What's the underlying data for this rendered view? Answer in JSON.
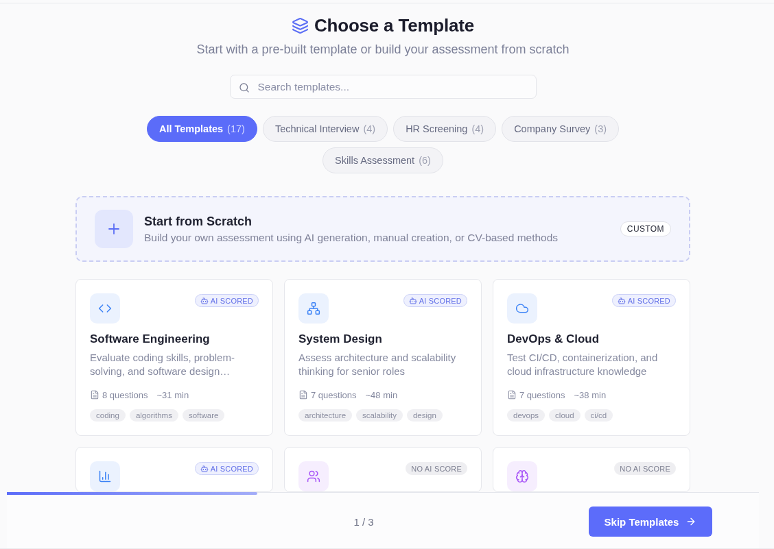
{
  "header": {
    "title": "Choose a Template",
    "subtitle": "Start with a pre-built template or build your assessment from scratch"
  },
  "search": {
    "placeholder": "Search templates..."
  },
  "filters": [
    {
      "label": "All Templates",
      "count": "(17)",
      "selected": true
    },
    {
      "label": "Technical Interview",
      "count": "(4)",
      "selected": false
    },
    {
      "label": "HR Screening",
      "count": "(4)",
      "selected": false
    },
    {
      "label": "Company Survey",
      "count": "(3)",
      "selected": false
    },
    {
      "label": "Skills Assessment",
      "count": "(6)",
      "selected": false
    }
  ],
  "scratch_card": {
    "title": "Start from Scratch",
    "description": "Build your own assessment using AI generation, manual creation, or CV-based methods",
    "badge": "CUSTOM"
  },
  "templates": [
    {
      "badge": "AI SCORED",
      "scored": true,
      "color": "#3b82f6",
      "title": "Software Engineering",
      "description": "Evaluate coding skills, problem-solving, and software design…",
      "questions": "8 questions",
      "duration": "~31 min",
      "tags": [
        "coding",
        "algorithms",
        "software"
      ]
    },
    {
      "badge": "AI SCORED",
      "scored": true,
      "color": "#3b82f6",
      "title": "System Design",
      "description": "Assess architecture and scalability thinking for senior roles",
      "questions": "7 questions",
      "duration": "~48 min",
      "tags": [
        "architecture",
        "scalability",
        "design"
      ]
    },
    {
      "badge": "AI SCORED",
      "scored": true,
      "color": "#3b82f6",
      "title": "DevOps & Cloud",
      "description": "Test CI/CD, containerization, and cloud infrastructure knowledge",
      "questions": "7 questions",
      "duration": "~38 min",
      "tags": [
        "devops",
        "cloud",
        "ci/cd"
      ]
    },
    {
      "badge": "AI SCORED",
      "scored": true,
      "color": "#3b82f6"
    },
    {
      "badge": "NO AI SCORE",
      "scored": false,
      "color": "#a855f7"
    },
    {
      "badge": "NO AI SCORE",
      "scored": false,
      "color": "#a855f7"
    }
  ],
  "footer": {
    "progress": {
      "level": 0.333
    },
    "page": "1 / 3",
    "skip_button": "Skip Templates"
  }
}
